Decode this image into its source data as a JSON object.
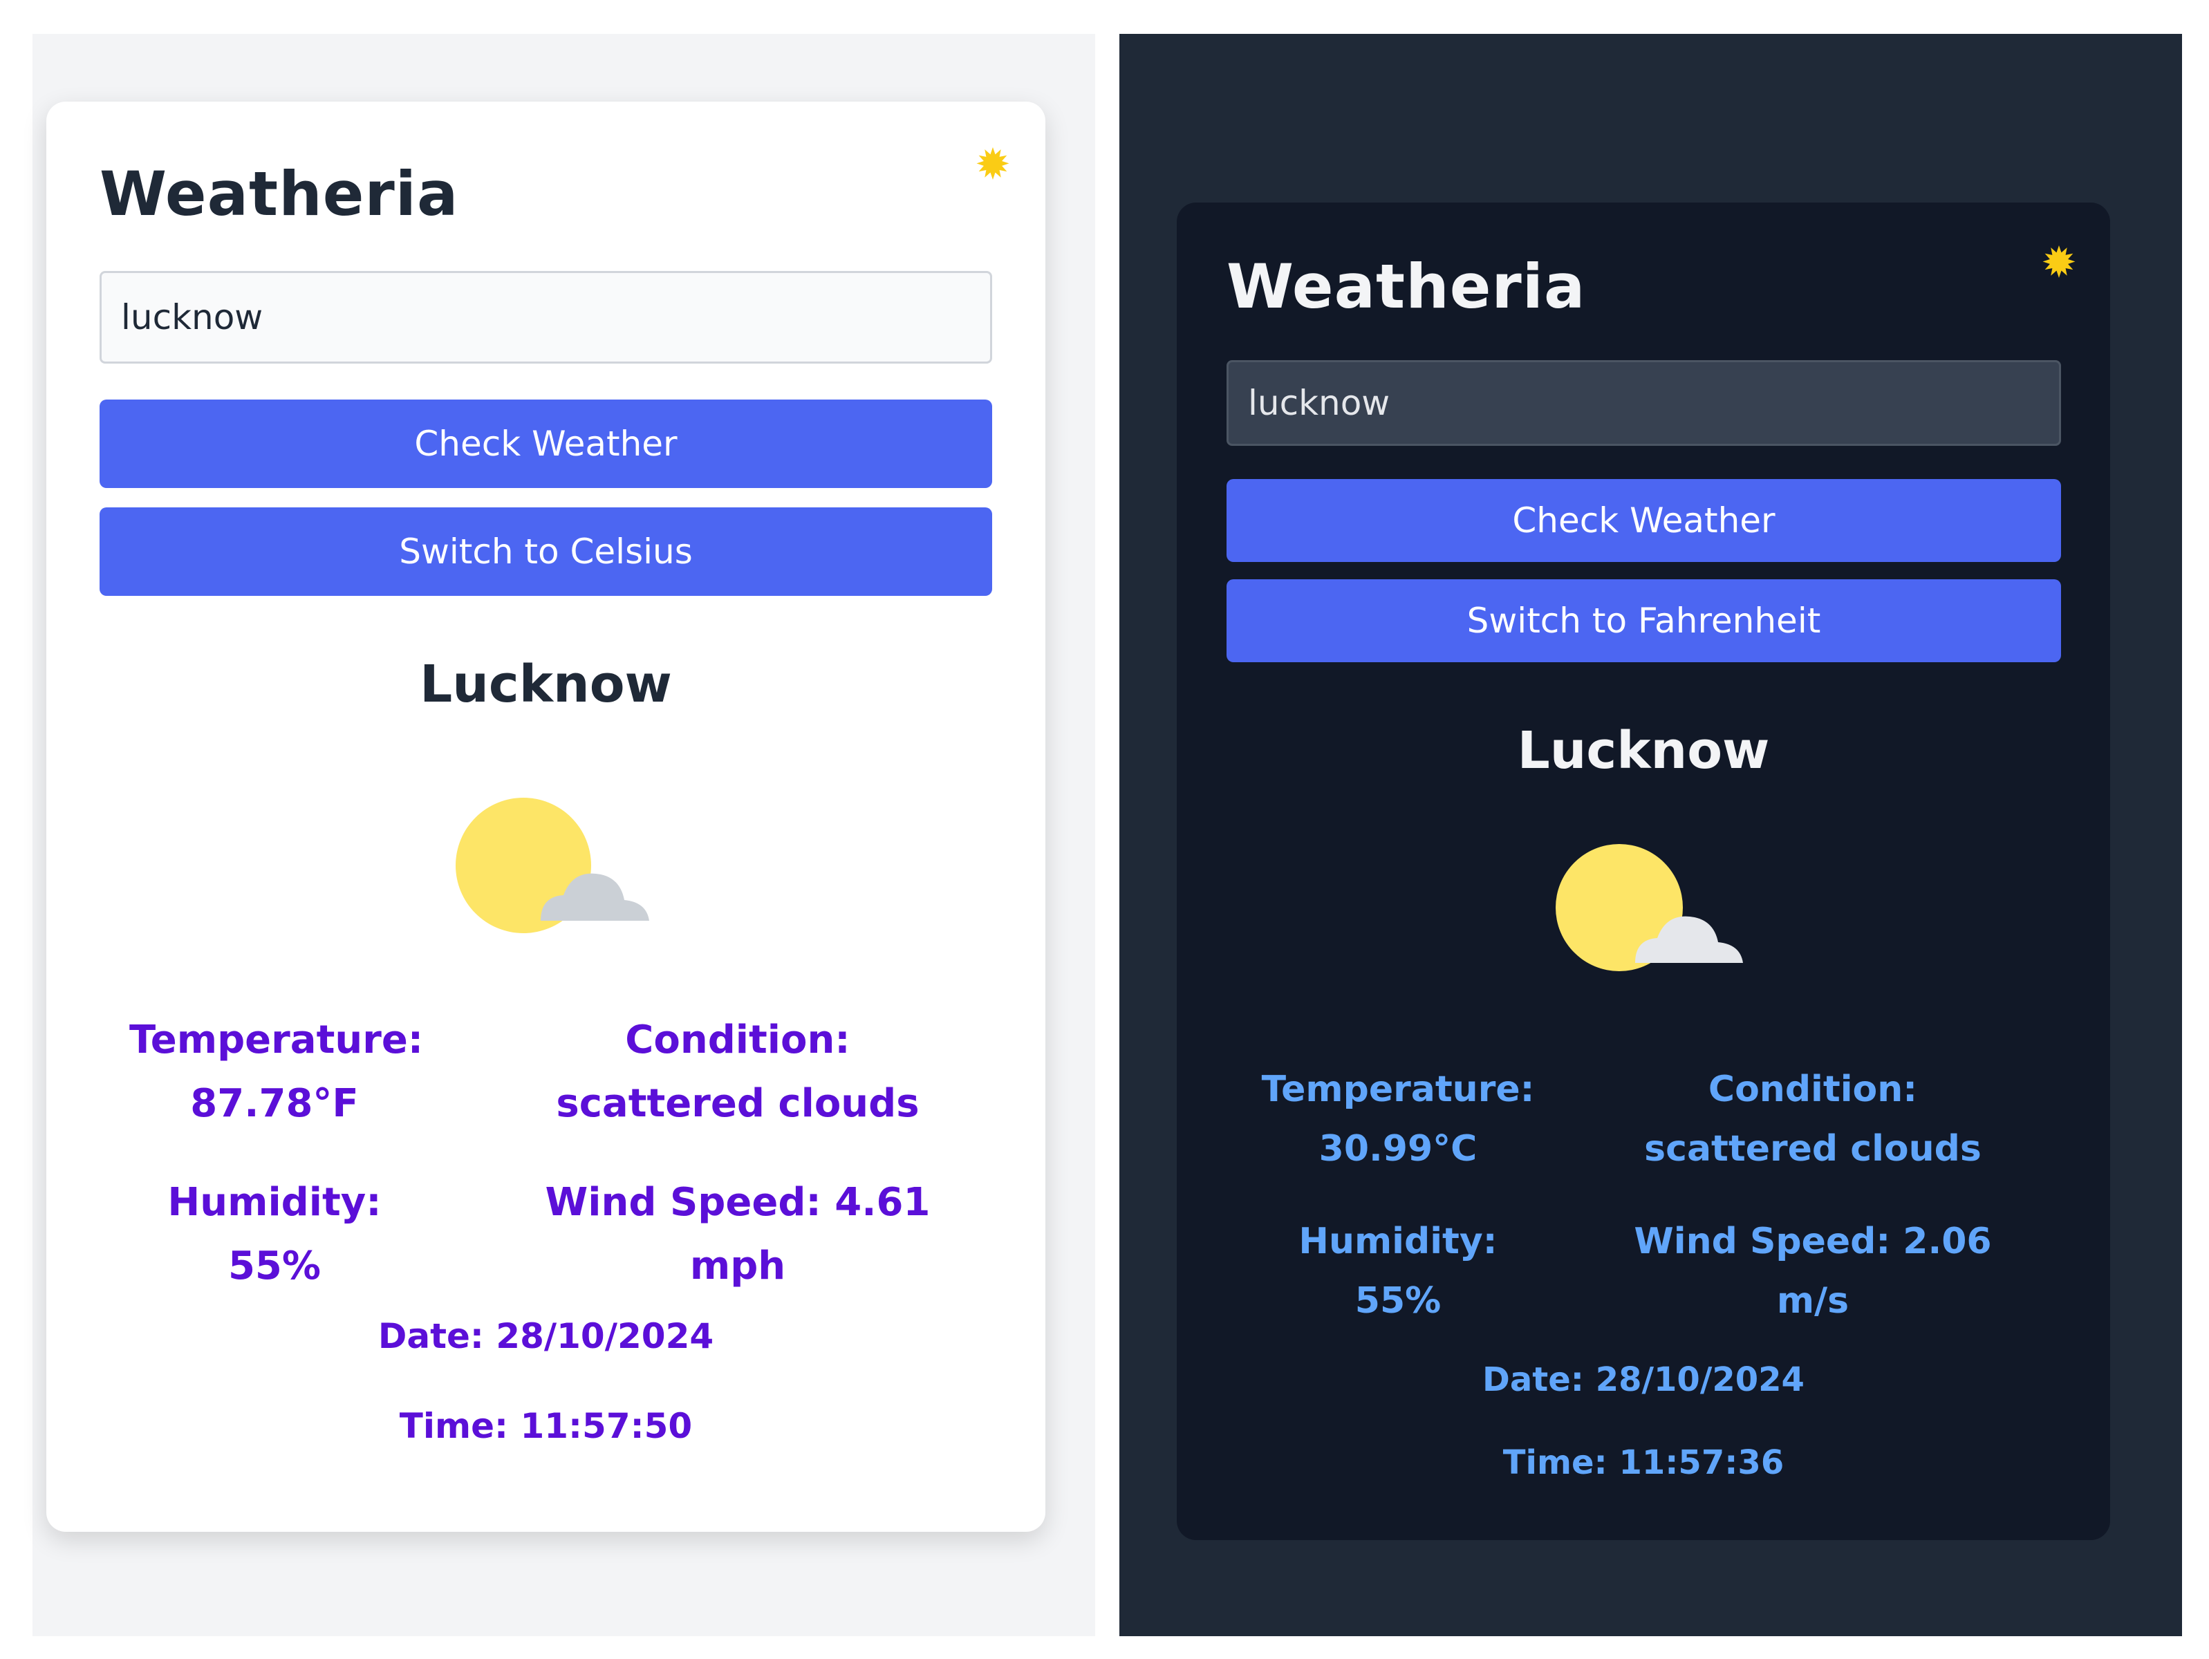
{
  "colors": {
    "accent_button": "#4c66f2",
    "light_text_stats": "#5b0fd8",
    "dark_text_stats": "#60a5fa",
    "sun": "#fde567",
    "cloud": "#d1d5db",
    "toggle_icon": "#facc15"
  },
  "light": {
    "theme_icon": "sun-icon",
    "title": "Weatheria",
    "input_value": "lucknow",
    "check_label": "Check Weather",
    "unit_label": "Switch to Celsius",
    "city": "Lucknow",
    "weather_icon": "partly-cloudy-icon",
    "temperature": "Temperature: 87.78°F",
    "condition": "Condition: scattered clouds",
    "humidity": "Humidity: 55%",
    "wind": "Wind Speed: 4.61 mph",
    "date": "Date: 28/10/2024",
    "time": "Time: 11:57:50"
  },
  "dark": {
    "theme_icon": "sun-icon",
    "title": "Weatheria",
    "input_value": "lucknow",
    "check_label": "Check Weather",
    "unit_label": "Switch to Fahrenheit",
    "city": "Lucknow",
    "weather_icon": "partly-cloudy-icon",
    "temperature": "Temperature: 30.99°C",
    "condition": "Condition: scattered clouds",
    "humidity": "Humidity: 55%",
    "wind": "Wind Speed: 2.06 m/s",
    "date": "Date: 28/10/2024",
    "time": "Time: 11:57:36"
  }
}
